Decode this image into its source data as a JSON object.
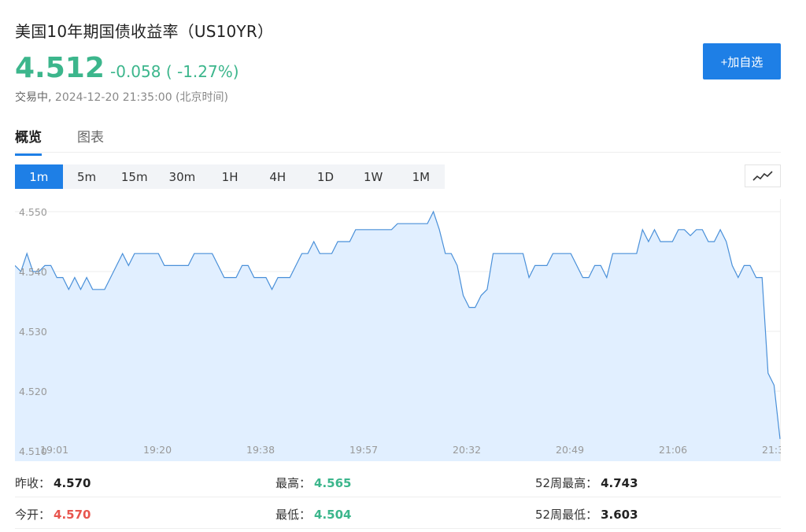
{
  "header": {
    "title": "美国10年期国债收益率（US10YR）",
    "price": "4.512",
    "change": "-0.058 ( -1.27%)",
    "status_label": "交易中,",
    "status_time": "2024-12-20 21:35:00 (北京时间)",
    "watch_button": "+加自选"
  },
  "colors": {
    "up_green": "#3cb68c",
    "down_red": "#e8554e",
    "accent": "#1e7fe6",
    "line": "#4a90d9",
    "fill": "#e1efff"
  },
  "tabs": [
    {
      "label": "概览",
      "active": true
    },
    {
      "label": "图表",
      "active": false
    }
  ],
  "periods": [
    "1m",
    "5m",
    "15m",
    "30m",
    "1H",
    "4H",
    "1D",
    "1W",
    "1M"
  ],
  "active_period": "1m",
  "chart_type_icon": "line-chart-icon",
  "chart_data": {
    "type": "area",
    "title": "",
    "xlabel": "",
    "ylabel": "",
    "ylim": [
      4.51,
      4.552
    ],
    "yticks": [
      "4.550",
      "4.540",
      "4.530",
      "4.520",
      "4.510"
    ],
    "xticks": [
      "19:01",
      "19:20",
      "19:38",
      "19:57",
      "20:32",
      "20:49",
      "21:06",
      "21:3"
    ],
    "grid": true,
    "series": [
      {
        "values": [
          4.541,
          4.54,
          4.543,
          4.54,
          4.54,
          4.541,
          4.541,
          4.539,
          4.539,
          4.537,
          4.539,
          4.537,
          4.539,
          4.537,
          4.537,
          4.537,
          4.539,
          4.541,
          4.543,
          4.541,
          4.543,
          4.543,
          4.543,
          4.543,
          4.543,
          4.541,
          4.541,
          4.541,
          4.541,
          4.541,
          4.543,
          4.543,
          4.543,
          4.543,
          4.541,
          4.539,
          4.539,
          4.539,
          4.541,
          4.541,
          4.539,
          4.539,
          4.539,
          4.537,
          4.539,
          4.539,
          4.539,
          4.541,
          4.543,
          4.543,
          4.545,
          4.543,
          4.543,
          4.543,
          4.545,
          4.545,
          4.545,
          4.547,
          4.547,
          4.547,
          4.547,
          4.547,
          4.547,
          4.547,
          4.548,
          4.548,
          4.548,
          4.548,
          4.548,
          4.548,
          4.55,
          4.547,
          4.543,
          4.543,
          4.541,
          4.536,
          4.534,
          4.534,
          4.536,
          4.537,
          4.543,
          4.543,
          4.543,
          4.543,
          4.543,
          4.543,
          4.539,
          4.541,
          4.541,
          4.541,
          4.543,
          4.543,
          4.543,
          4.543,
          4.541,
          4.539,
          4.539,
          4.541,
          4.541,
          4.539,
          4.543,
          4.543,
          4.543,
          4.543,
          4.543,
          4.547,
          4.545,
          4.547,
          4.545,
          4.545,
          4.545,
          4.547,
          4.547,
          4.546,
          4.547,
          4.547,
          4.545,
          4.545,
          4.547,
          4.545,
          4.541,
          4.539,
          4.541,
          4.541,
          4.539,
          4.539,
          4.523,
          4.521,
          4.512
        ]
      }
    ]
  },
  "stats": [
    [
      {
        "label": "昨收：",
        "value": "4.570",
        "tone": ""
      },
      {
        "label": "最高：",
        "value": "4.565",
        "tone": "green"
      },
      {
        "label": "52周最高：",
        "value": "4.743",
        "tone": ""
      }
    ],
    [
      {
        "label": "今开：",
        "value": "4.570",
        "tone": "red"
      },
      {
        "label": "最低：",
        "value": "4.504",
        "tone": "green"
      },
      {
        "label": "52周最低：",
        "value": "3.603",
        "tone": ""
      }
    ]
  ]
}
